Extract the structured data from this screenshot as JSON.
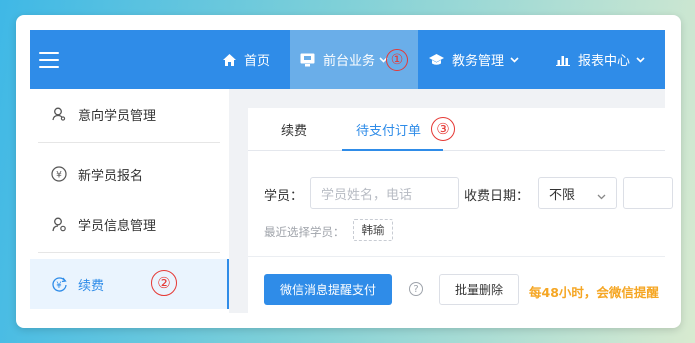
{
  "topnav": {
    "items": [
      {
        "label": "首页",
        "icon": "home-icon"
      },
      {
        "label": "前台业务",
        "icon": "monitor-icon",
        "marker": "①"
      },
      {
        "label": "教务管理",
        "icon": "graduation-cap-icon"
      },
      {
        "label": "报表中心",
        "icon": "bar-chart-icon"
      }
    ]
  },
  "sidebar": {
    "items": [
      {
        "label": "意向学员管理",
        "icon": "user-icon"
      },
      {
        "label": "新学员报名",
        "icon": "yen-circle-icon"
      },
      {
        "label": "学员信息管理",
        "icon": "user-settings-icon"
      },
      {
        "label": "续费",
        "icon": "yen-refresh-icon",
        "marker": "②"
      }
    ]
  },
  "tabs": [
    {
      "label": "续费"
    },
    {
      "label": "待支付订单",
      "marker": "③"
    }
  ],
  "form": {
    "student_label": "学员：",
    "student_placeholder": "学员姓名，电话",
    "date_label": "收费日期：",
    "date_select": "不限",
    "recent_label": "最近选择学员：",
    "recent_tag": "韩瑜"
  },
  "actions": {
    "wechat_remind_pay": "微信消息提醒支付",
    "help": "?",
    "batch_delete": "批量删除",
    "notice": "每48小时，会微信提醒"
  },
  "colors": {
    "primary": "#2f8ce8",
    "marker": "#e53935",
    "notice": "#f5a623"
  }
}
